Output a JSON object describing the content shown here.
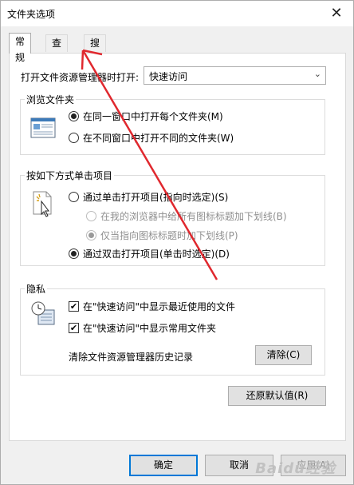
{
  "window": {
    "title": "文件夹选项",
    "close_glyph": "✕"
  },
  "tabs": [
    {
      "label": "常规",
      "active": true
    },
    {
      "label": "查看",
      "active": false
    },
    {
      "label": "搜索",
      "active": false
    }
  ],
  "open_in": {
    "label": "打开文件资源管理器时打开:",
    "value": "快速访问",
    "arrow_glyph": "⌄"
  },
  "browse_folders": {
    "title": "浏览文件夹",
    "option_same_window": {
      "label": "在同一窗口中打开每个文件夹(M)",
      "selected": true
    },
    "option_new_window": {
      "label": "在不同窗口中打开不同的文件夹(W)",
      "selected": false
    }
  },
  "click_items": {
    "title": "按如下方式单击项目",
    "option_single_click": {
      "label": "通过单击打开项目(指向时选定)(S)",
      "selected": false
    },
    "sub_underline_always": {
      "label": "在我的浏览器中给所有图标标题加下划线(B)",
      "selected": false,
      "disabled": true
    },
    "sub_underline_point": {
      "label": "仅当指向图标标题时加下划线(P)",
      "selected": true,
      "disabled": true
    },
    "option_double_click": {
      "label": "通过双击打开项目(单击时选定)(D)",
      "selected": true
    }
  },
  "privacy": {
    "title": "隐私",
    "show_recent_files": {
      "label": "在\"快速访问\"中显示最近使用的文件",
      "checked": true
    },
    "show_frequent_folders": {
      "label": "在\"快速访问\"中显示常用文件夹",
      "checked": true
    },
    "clear_history_label": "清除文件资源管理器历史记录",
    "clear_button": "清除(C)"
  },
  "restore_defaults_button": "还原默认值(R)",
  "footer": {
    "ok_button": "确定",
    "cancel_button": "取消",
    "apply_button": "应用(A)"
  },
  "watermark": "Baidu经验",
  "colors": {
    "annotation_red": "#e0282e",
    "default_button_border": "#0078d7"
  }
}
